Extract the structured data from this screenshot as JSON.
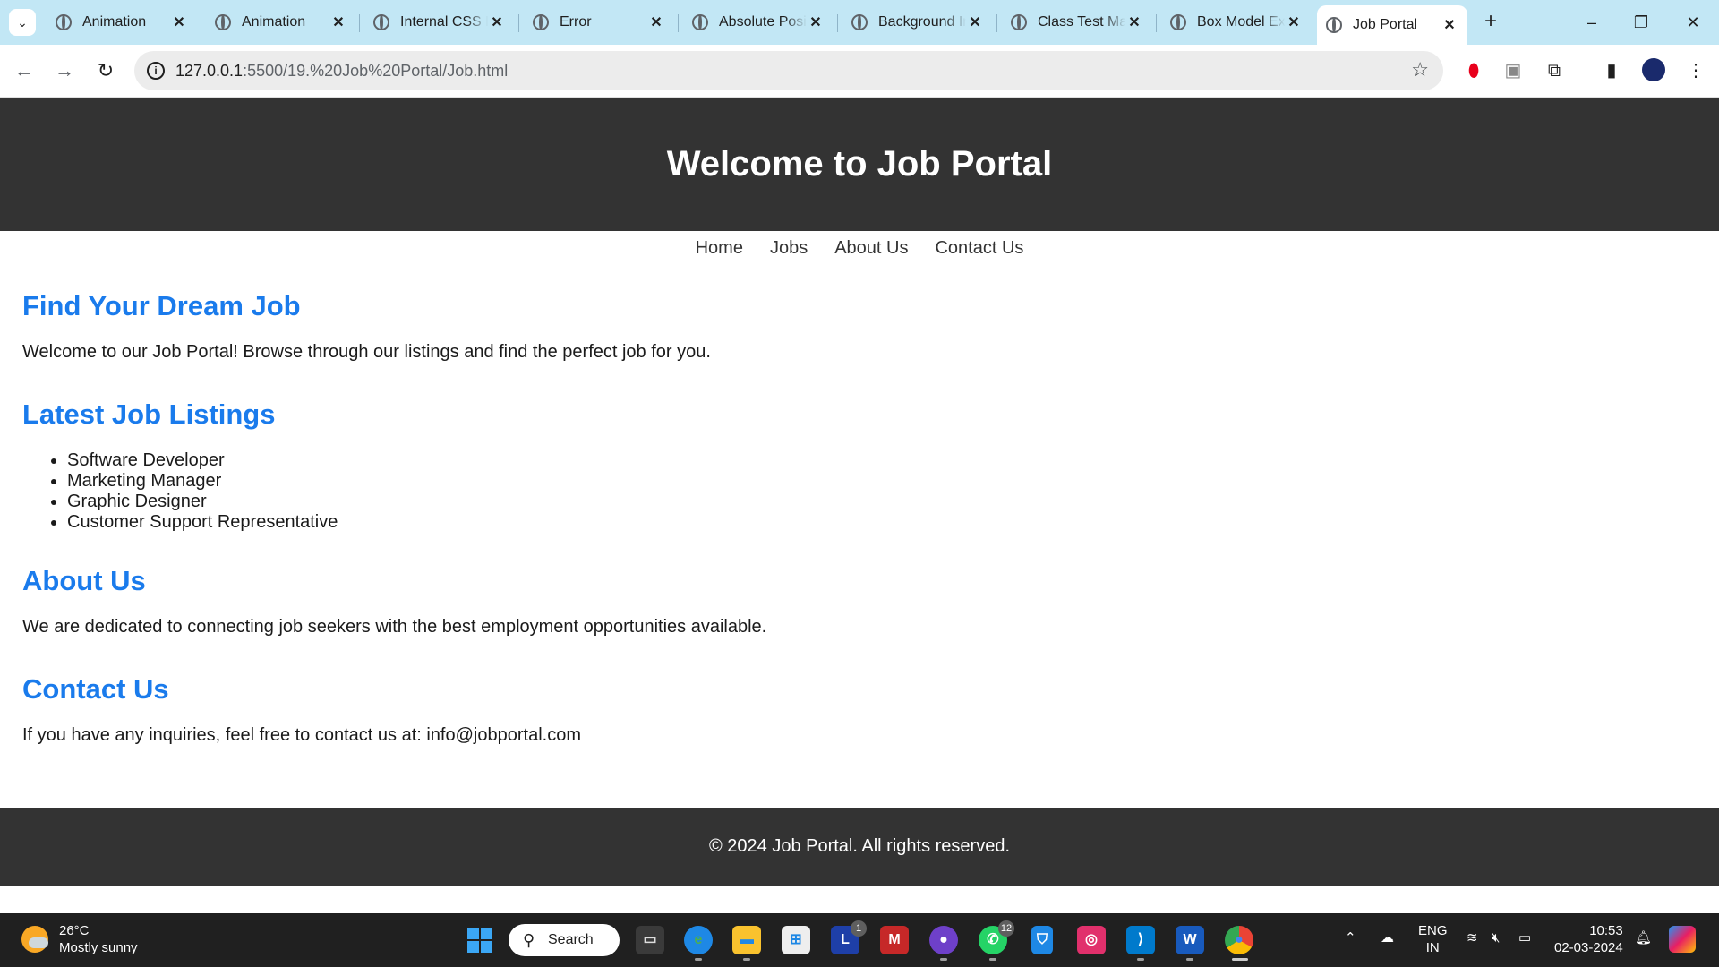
{
  "browser": {
    "tabs": [
      {
        "title": "Animation"
      },
      {
        "title": "Animation"
      },
      {
        "title": "Internal CSS Example"
      },
      {
        "title": "Error"
      },
      {
        "title": "Absolute Positioning"
      },
      {
        "title": "Background Image"
      },
      {
        "title": "Class Test Marks"
      },
      {
        "title": "Box Model Example"
      },
      {
        "title": "Job Portal"
      }
    ],
    "url_host": "127.0.0.1",
    "url_rest": ":5500/19.%20Job%20Portal/Job.html"
  },
  "site": {
    "header_title": "Welcome to Job Portal",
    "nav": [
      "Home",
      "Jobs",
      "About Us",
      "Contact Us"
    ],
    "find": {
      "heading": "Find Your Dream Job",
      "text": "Welcome to our Job Portal! Browse through our listings and find the perfect job for you."
    },
    "listings": {
      "heading": "Latest Job Listings",
      "items": [
        "Software Developer",
        "Marketing Manager",
        "Graphic Designer",
        "Customer Support Representative"
      ]
    },
    "about": {
      "heading": "About Us",
      "text": "We are dedicated to connecting job seekers with the best employment opportunities available."
    },
    "contact": {
      "heading": "Contact Us",
      "text": "If you have any inquiries, feel free to contact us at: info@jobportal.com"
    },
    "footer": "© 2024 Job Portal. All rights reserved."
  },
  "taskbar": {
    "weather_temp": "26°C",
    "weather_desc": "Mostly sunny",
    "search_label": "Search",
    "lang_top": "ENG",
    "lang_bottom": "IN",
    "time": "10:53",
    "date": "02-03-2024",
    "badge_l": "1",
    "badge_whatsapp": "12"
  },
  "colors": {
    "accent_heading": "#1a7bec",
    "header_bg": "#333333",
    "tabstrip_bg": "#c2e7f5"
  }
}
